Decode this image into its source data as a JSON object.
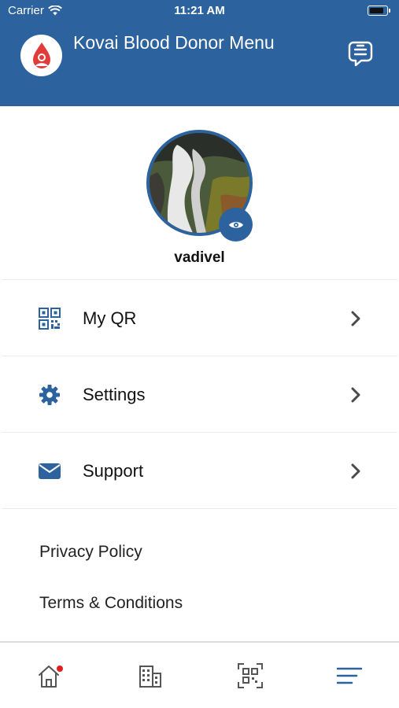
{
  "status_bar": {
    "carrier": "Carrier",
    "time": "11:21 AM"
  },
  "header": {
    "title": "Kovai Blood Donor Menu",
    "logo_icon": "blood-drop-person-icon",
    "action_icon": "chat-icon"
  },
  "profile": {
    "username": "vadivel",
    "view_icon": "eye-icon"
  },
  "menu": {
    "items": [
      {
        "label": "My QR",
        "icon": "qr-code-icon"
      },
      {
        "label": "Settings",
        "icon": "gear-icon"
      },
      {
        "label": "Support",
        "icon": "envelope-icon"
      }
    ]
  },
  "links": {
    "privacy": "Privacy Policy",
    "terms": "Terms & Conditions"
  },
  "tabbar": {
    "tabs": [
      {
        "name": "home",
        "icon": "home-icon",
        "badge": true
      },
      {
        "name": "organizations",
        "icon": "building-icon"
      },
      {
        "name": "scan",
        "icon": "qr-scan-icon"
      },
      {
        "name": "menu",
        "icon": "menu-icon",
        "active": true
      }
    ]
  },
  "colors": {
    "primary": "#2c629e",
    "badge": "#e02020",
    "text": "#111111"
  }
}
